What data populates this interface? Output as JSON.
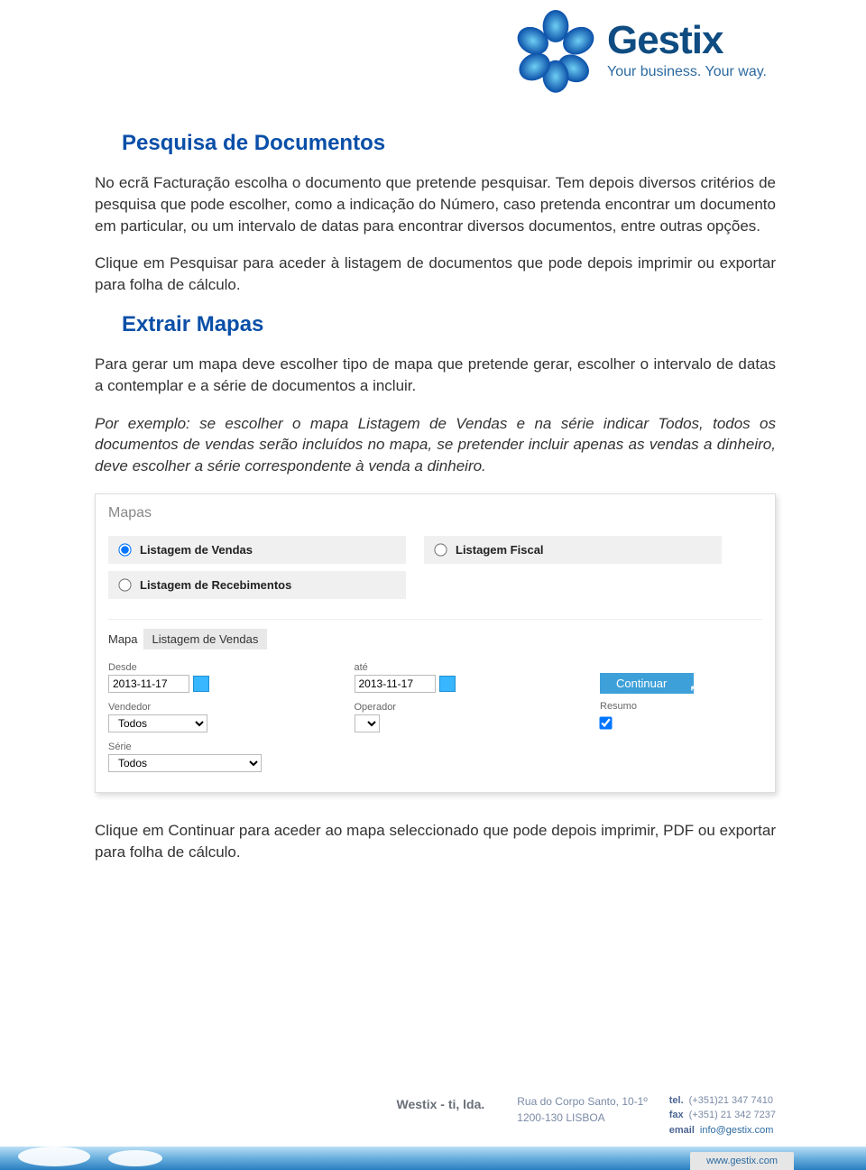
{
  "brand": {
    "name": "Gestix",
    "tagline": "Your business. Your way."
  },
  "section1": {
    "heading": "Pesquisa de Documentos",
    "p1": "No ecrã Facturação escolha o documento que pretende pesquisar. Tem depois diversos critérios de pesquisa que pode escolher, como a indicação do Número, caso pretenda encontrar um documento em particular, ou um intervalo de datas para encontrar diversos documentos, entre outras opções.",
    "p2": "Clique em Pesquisar para aceder à listagem de documentos que pode depois imprimir ou exportar para folha de cálculo."
  },
  "section2": {
    "heading": "Extrair Mapas",
    "p1": "Para gerar um mapa deve escolher tipo de mapa que pretende gerar, escolher o intervalo de datas a contemplar e a série de documentos a incluir.",
    "p2": "Por exemplo: se escolher o mapa Listagem de Vendas e na série indicar Todos, todos os documentos de vendas serão incluídos no mapa, se pretender incluir apenas as vendas a dinheiro, deve escolher a série correspondente à venda a dinheiro."
  },
  "mapas": {
    "title": "Mapas",
    "options": {
      "vendas": "Listagem de Vendas",
      "fiscal": "Listagem Fiscal",
      "recebimentos": "Listagem de Recebimentos"
    },
    "selected_label": "Mapa",
    "selected_value": "Listagem de Vendas",
    "fields": {
      "desde": "Desde",
      "ate": "até",
      "vendedor": "Vendedor",
      "operador": "Operador",
      "serie": "Série",
      "resumo": "Resumo"
    },
    "values": {
      "date_from": "2013-11-17",
      "date_to": "2013-11-17",
      "vendedor": "Todos",
      "serie": "Todos"
    },
    "continue": "Continuar"
  },
  "outro": "Clique em Continuar para aceder ao mapa seleccionado que pode depois imprimir, PDF ou exportar para folha de cálculo.",
  "footer": {
    "company": "Westix - ti, lda.",
    "addr1": "Rua do Corpo Santo, 10-1º",
    "addr2": "1200-130 LISBOA",
    "tel_lbl": "tel.",
    "tel": "(+351)21 347 7410",
    "fax_lbl": "fax",
    "fax": "(+351) 21 342 7237",
    "email_lbl": "email",
    "email": "info@gestix.com",
    "site": "www.gestix.com"
  }
}
